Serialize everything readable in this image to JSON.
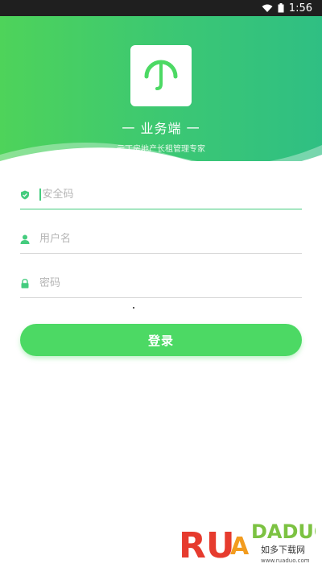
{
  "status_bar": {
    "time": "1:56",
    "icons": [
      "wifi-icon",
      "battery-icon"
    ]
  },
  "header": {
    "logo_icon": "umbrella-icon",
    "title": "一 业务端 一",
    "subtitle": "云丁房地产长租管理专家"
  },
  "form": {
    "security_code": {
      "icon": "shield-icon",
      "placeholder": "安全码",
      "value": ""
    },
    "username": {
      "icon": "user-icon",
      "placeholder": "用户名",
      "value": ""
    },
    "password": {
      "icon": "lock-icon",
      "placeholder": "密码",
      "value": ""
    }
  },
  "login_button": {
    "label": "登录"
  },
  "watermark": {
    "brand": "RUANDADUO",
    "chinese": "如多下载网",
    "url": "www.ruaduo.com"
  },
  "colors": {
    "primary_green": "#4cd964",
    "header_gradient_start": "#4ed35a",
    "header_gradient_end": "#2fbf83",
    "active_underline": "#44cc7e"
  }
}
